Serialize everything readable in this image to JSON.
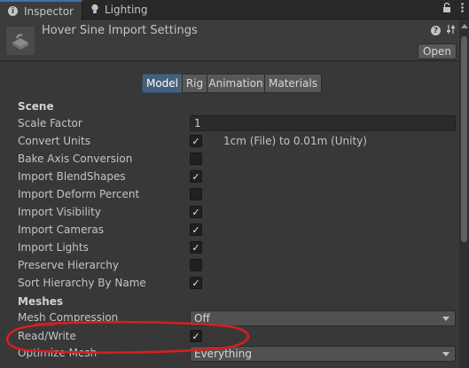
{
  "tabs": [
    {
      "label": "Inspector",
      "icon": "info-icon",
      "active": true
    },
    {
      "label": "Lighting",
      "icon": "lightbulb-icon",
      "active": false
    }
  ],
  "tabbar_icons": [
    "lock-icon",
    "menu-icon"
  ],
  "header": {
    "title": "Hover Sine Import Settings",
    "open_label": "Open",
    "icons": [
      "help-icon",
      "preset-icon",
      "overflow-menu-icon"
    ]
  },
  "subtabs": [
    "Model",
    "Rig",
    "Animation",
    "Materials"
  ],
  "active_subtab": "Model",
  "scene": {
    "title": "Scene",
    "scale_factor": {
      "label": "Scale Factor",
      "value": "1"
    },
    "convert_units": {
      "label": "Convert Units",
      "checked": true,
      "note": "1cm (File) to 0.01m (Unity)"
    },
    "bake_axis_conversion": {
      "label": "Bake Axis Conversion",
      "checked": false
    },
    "import_blendshapes": {
      "label": "Import BlendShapes",
      "checked": true
    },
    "import_deform_percent": {
      "label": "Import Deform Percent",
      "checked": false
    },
    "import_visibility": {
      "label": "Import Visibility",
      "checked": true
    },
    "import_cameras": {
      "label": "Import Cameras",
      "checked": true
    },
    "import_lights": {
      "label": "Import Lights",
      "checked": true
    },
    "preserve_hierarchy": {
      "label": "Preserve Hierarchy",
      "checked": false
    },
    "sort_hierarchy_by_name": {
      "label": "Sort Hierarchy By Name",
      "checked": true
    }
  },
  "meshes": {
    "title": "Meshes",
    "mesh_compression": {
      "label": "Mesh Compression",
      "value": "Off"
    },
    "read_write": {
      "label": "Read/Write",
      "checked": true
    },
    "optimize_mesh": {
      "label": "Optimize Mesh",
      "value": "Everything"
    }
  },
  "checkmark_glyph": "✓",
  "colors": {
    "background": "#383838",
    "active_tab_accent": "#3a72b0",
    "active_subtab": "#46607c",
    "annotation": "#d42020"
  }
}
